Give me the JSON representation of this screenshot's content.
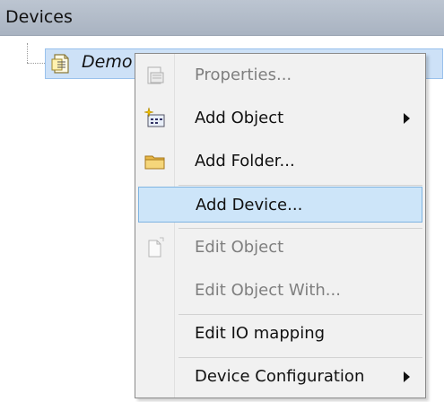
{
  "panel": {
    "title": "Devices"
  },
  "tree": {
    "node_label": "Demo",
    "node_icon": "document-icon"
  },
  "context_menu": {
    "items": [
      {
        "label": "Properties...",
        "icon": "properties-icon",
        "enabled": false,
        "submenu": false
      },
      {
        "label": "Add Object",
        "icon": "add-object-icon",
        "enabled": true,
        "submenu": true
      },
      {
        "label": "Add Folder...",
        "icon": "folder-icon",
        "enabled": true,
        "submenu": false
      },
      {
        "label": "Add Device...",
        "icon": "",
        "enabled": true,
        "submenu": false,
        "selected": true
      },
      {
        "label": "Edit Object",
        "icon": "edit-object-icon",
        "enabled": false,
        "submenu": false
      },
      {
        "label": "Edit Object With...",
        "icon": "",
        "enabled": false,
        "submenu": false
      },
      {
        "label": "Edit IO mapping",
        "icon": "",
        "enabled": true,
        "submenu": false
      },
      {
        "label": "Device Configuration",
        "icon": "",
        "enabled": true,
        "submenu": true
      }
    ]
  },
  "colors": {
    "header_bg": "#b2bcca",
    "selection_bg": "#cde5f9",
    "selection_border": "#7fb4e2",
    "menu_bg": "#f1f1f1",
    "disabled_text": "#7f7f7f"
  }
}
